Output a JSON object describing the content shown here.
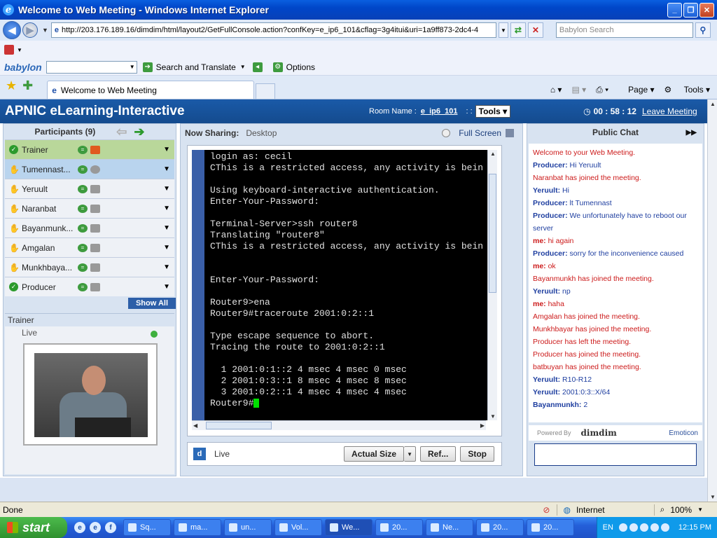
{
  "window": {
    "title": "Welcome to Web Meeting - Windows Internet Explorer"
  },
  "address": {
    "url": "http://203.176.189.16/dimdim/html/layout2/GetFullConsole.action?confKey=e_ip6_101&cflag=3g4itui&uri=1a9ff873-2dc4-4",
    "search_placeholder": "Babylon Search"
  },
  "babylon_toolbar": {
    "brand": "babylon",
    "search_translate": "Search and Translate",
    "options": "Options"
  },
  "tabs": [
    {
      "label": "Welcome to Web Meeting"
    }
  ],
  "commands": {
    "page": "Page",
    "tools": "Tools"
  },
  "app": {
    "title": "APNIC eLearning-Interactive",
    "room_label": "Room Name :",
    "room_name": "e_ip6_101",
    "sep": ": :",
    "tools": "Tools",
    "timer": "00 : 58 : 12",
    "leave": "Leave Meeting"
  },
  "participants": {
    "title": "Participants (9)",
    "show_all": "Show All",
    "items": [
      {
        "name": "Trainer"
      },
      {
        "name": "Tumennast..."
      },
      {
        "name": "Yeruult"
      },
      {
        "name": "Naranbat"
      },
      {
        "name": "Bayanmunk..."
      },
      {
        "name": "Amgalan"
      },
      {
        "name": "Munkhbaya..."
      },
      {
        "name": "Producer"
      }
    ]
  },
  "trainer_panel": {
    "title": "Trainer",
    "status": "Live"
  },
  "sharing": {
    "label": "Now Sharing:",
    "what": "Desktop",
    "full_screen": "Full Screen",
    "terminal_lines": [
      "login as: cecil",
      "CThis is a restricted access, any activity is bein",
      "",
      "Using keyboard-interactive authentication.",
      "Enter-Your-Password:",
      "",
      "Terminal-Server>ssh router8",
      "Translating \"router8\"",
      "CThis is a restricted access, any activity is bein",
      "",
      "",
      "Enter-Your-Password:",
      "",
      "Router9>ena",
      "Router9#traceroute 2001:0:2::1",
      "",
      "Type escape sequence to abort.",
      "Tracing the route to 2001:0:2::1",
      "",
      "  1 2001:0:1::2 4 msec 4 msec 0 msec",
      "  2 2001:0:3::1 8 msec 4 msec 8 msec",
      "  3 2001:0:2::1 4 msec 4 msec 4 msec",
      "Router9#"
    ],
    "live": "Live",
    "actual_size": "Actual Size",
    "refresh": "Ref...",
    "stop": "Stop"
  },
  "chat": {
    "title": "Public Chat",
    "powered_by": "Powered By",
    "brand": "dimdim",
    "emoticon": "Emoticon",
    "messages": [
      {
        "type": "sys",
        "text": "Welcome to your Web Meeting."
      },
      {
        "type": "user",
        "from": "Producer:",
        "text": "Hi Yeruult"
      },
      {
        "type": "sys",
        "text": "Naranbat has joined the meeting."
      },
      {
        "type": "user",
        "from": "Yeruult:",
        "text": "Hi"
      },
      {
        "type": "user",
        "from": "Producer:",
        "text": "lt Tumennast"
      },
      {
        "type": "user",
        "from": "Producer:",
        "text": "We unfortunately have to reboot our server"
      },
      {
        "type": "me",
        "from": "me:",
        "text": "hi again"
      },
      {
        "type": "user",
        "from": "Producer:",
        "text": "sorry for the inconvenience caused"
      },
      {
        "type": "me",
        "from": "me:",
        "text": "ok"
      },
      {
        "type": "sys",
        "text": "Bayanmunkh has joined the meeting."
      },
      {
        "type": "user",
        "from": "Yeruult:",
        "text": "np"
      },
      {
        "type": "me",
        "from": "me:",
        "text": "haha"
      },
      {
        "type": "sys",
        "text": "Amgalan has joined the meeting."
      },
      {
        "type": "sys",
        "text": "Munkhbayar has joined the meeting."
      },
      {
        "type": "sys",
        "text": "Producer has left the meeting."
      },
      {
        "type": "sys",
        "text": "Producer has joined the meeting."
      },
      {
        "type": "sys",
        "text": "batbuyan has joined the meeting."
      },
      {
        "type": "user",
        "from": "Yeruult:",
        "text": "R10-R12"
      },
      {
        "type": "user",
        "from": "Yeruult:",
        "text": "2001:0:3::X/64"
      },
      {
        "type": "user",
        "from": "Bayanmunkh:",
        "text": "2"
      }
    ]
  },
  "statusbar": {
    "text": "Done",
    "zone": "Internet",
    "zoom": "100%"
  },
  "taskbar": {
    "start": "start",
    "lang": "EN",
    "clock": "12:15 PM",
    "tasks": [
      "Sq...",
      "ma...",
      "un...",
      "Vol...",
      "We...",
      "20...",
      "Ne...",
      "20...",
      "20..."
    ]
  }
}
